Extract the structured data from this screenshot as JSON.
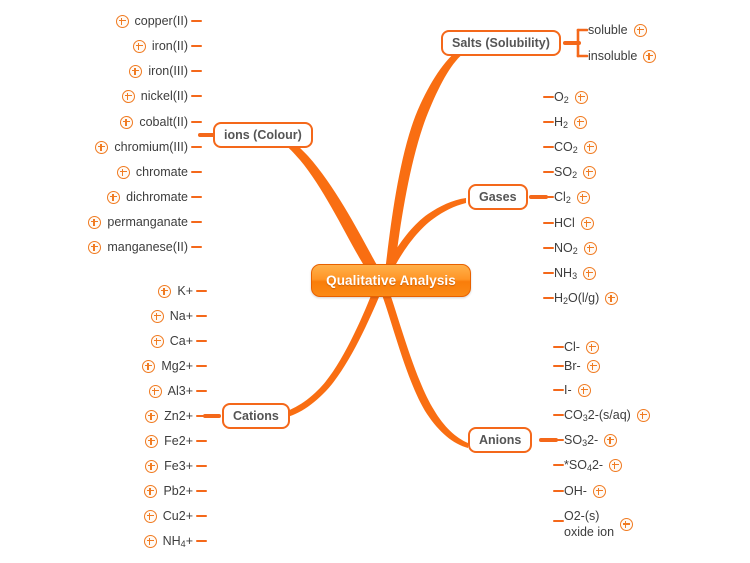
{
  "colors": {
    "branch_orange": "#f4681a",
    "node_border": "#f4681a",
    "node_text": "#555555",
    "leaf_text": "#3d3d3d",
    "root_fill_top": "#ffb04a",
    "root_fill_bottom": "#f97d0a",
    "root_text": "#ffffff",
    "icon_orange": "#f07b22",
    "canvas_background": "#ffffff"
  },
  "root": {
    "label": "Qualitative Analysis"
  },
  "branches": [
    {
      "id": "ions-colour",
      "label": "ions (Colour)",
      "side": "left",
      "children": [
        {
          "label": "copper(II)"
        },
        {
          "label": "iron(II)"
        },
        {
          "label": "iron(III)"
        },
        {
          "label": "nickel(II)"
        },
        {
          "label": "cobalt(II)"
        },
        {
          "label": "chromium(III)"
        },
        {
          "label": "chromate"
        },
        {
          "label": "dichromate"
        },
        {
          "label": "permanganate"
        },
        {
          "label": "manganese(II)"
        }
      ]
    },
    {
      "id": "salts-solubility",
      "label": "Salts (Solubility)",
      "side": "right",
      "children": [
        {
          "label": "soluble"
        },
        {
          "label": "insoluble"
        }
      ]
    },
    {
      "id": "gases",
      "label": "Gases",
      "side": "right",
      "children": [
        {
          "label": "O2",
          "formula": [
            {
              "t": "O"
            },
            {
              "t": "2",
              "sub": true
            }
          ]
        },
        {
          "label": "H2",
          "formula": [
            {
              "t": "H"
            },
            {
              "t": "2",
              "sub": true
            }
          ]
        },
        {
          "label": "CO2",
          "formula": [
            {
              "t": "CO"
            },
            {
              "t": "2",
              "sub": true
            }
          ]
        },
        {
          "label": "SO2",
          "formula": [
            {
              "t": "SO"
            },
            {
              "t": "2",
              "sub": true
            }
          ]
        },
        {
          "label": "Cl2",
          "formula": [
            {
              "t": "Cl"
            },
            {
              "t": "2",
              "sub": true
            }
          ]
        },
        {
          "label": "HCl",
          "formula": [
            {
              "t": "HCl"
            }
          ]
        },
        {
          "label": "NO2",
          "formula": [
            {
              "t": "NO"
            },
            {
              "t": "2",
              "sub": true
            }
          ]
        },
        {
          "label": "NH3",
          "formula": [
            {
              "t": "NH"
            },
            {
              "t": "3",
              "sub": true
            }
          ]
        },
        {
          "label": "H2O(l/g)",
          "formula": [
            {
              "t": "H"
            },
            {
              "t": "2",
              "sub": true
            },
            {
              "t": "O(l/g)"
            }
          ]
        }
      ]
    },
    {
      "id": "anions",
      "label": "Anions",
      "side": "right",
      "children": [
        {
          "label": "Cl-",
          "formula": [
            {
              "t": "Cl-"
            }
          ]
        },
        {
          "label": "Br-",
          "formula": [
            {
              "t": "Br-"
            }
          ]
        },
        {
          "label": "I-",
          "formula": [
            {
              "t": "I-"
            }
          ]
        },
        {
          "label": "CO32-(s/aq)",
          "formula": [
            {
              "t": "CO"
            },
            {
              "t": "3",
              "sub": true
            },
            {
              "t": "2-(s/aq)"
            }
          ]
        },
        {
          "label": "SO32-",
          "formula": [
            {
              "t": "SO"
            },
            {
              "t": "3",
              "sub": true
            },
            {
              "t": "2-"
            }
          ]
        },
        {
          "label": "*SO42-",
          "formula": [
            {
              "t": "*SO"
            },
            {
              "t": "4",
              "sub": true
            },
            {
              "t": "2-"
            }
          ]
        },
        {
          "label": "OH-",
          "formula": [
            {
              "t": "OH-"
            }
          ]
        },
        {
          "label": "O2-(s) oxide ion",
          "line1": "O2-(s)",
          "line2": "oxide ion"
        }
      ]
    },
    {
      "id": "cations",
      "label": "Cations",
      "side": "left",
      "children": [
        {
          "label": "K+",
          "formula": [
            {
              "t": "K+"
            }
          ]
        },
        {
          "label": "Na+",
          "formula": [
            {
              "t": "Na+"
            }
          ]
        },
        {
          "label": "Ca+",
          "formula": [
            {
              "t": "Ca+"
            }
          ]
        },
        {
          "label": "Mg2+",
          "formula": [
            {
              "t": "Mg2+"
            }
          ]
        },
        {
          "label": "Al3+",
          "formula": [
            {
              "t": "Al3+"
            }
          ]
        },
        {
          "label": "Zn2+",
          "formula": [
            {
              "t": "Zn2+"
            }
          ]
        },
        {
          "label": "Fe2+",
          "formula": [
            {
              "t": "Fe2+"
            }
          ]
        },
        {
          "label": "Fe3+",
          "formula": [
            {
              "t": "Fe3+"
            }
          ]
        },
        {
          "label": "Pb2+",
          "formula": [
            {
              "t": "Pb2+"
            }
          ]
        },
        {
          "label": "Cu2+",
          "formula": [
            {
              "t": "Cu2+"
            }
          ]
        },
        {
          "label": "NH4+",
          "formula": [
            {
              "t": "NH"
            },
            {
              "t": "4",
              "sub": true
            },
            {
              "t": "+"
            }
          ]
        }
      ]
    }
  ],
  "icons": {
    "expand": "plus-circle-icon"
  }
}
